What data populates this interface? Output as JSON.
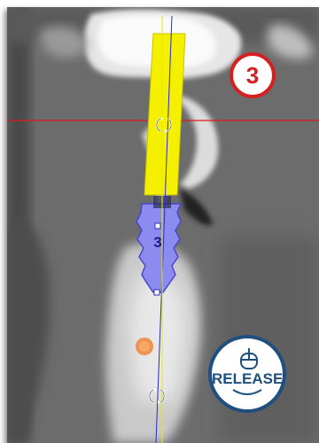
{
  "viewer": {
    "slice_number": "3",
    "implant_label": "3",
    "release_button_label": "RELEASE",
    "icons": [
      "mouse-icon",
      "rotate-handle-icon",
      "rotate-handle-icon"
    ]
  },
  "colors": {
    "abutment": "#f4f000",
    "implant": "#8c8cf0",
    "axis_line": "#e8e800",
    "horizontal_line": "#d81c1c",
    "marker": "#f08a40",
    "badge_border": "#d42020",
    "release_border": "#1f4f7e"
  }
}
